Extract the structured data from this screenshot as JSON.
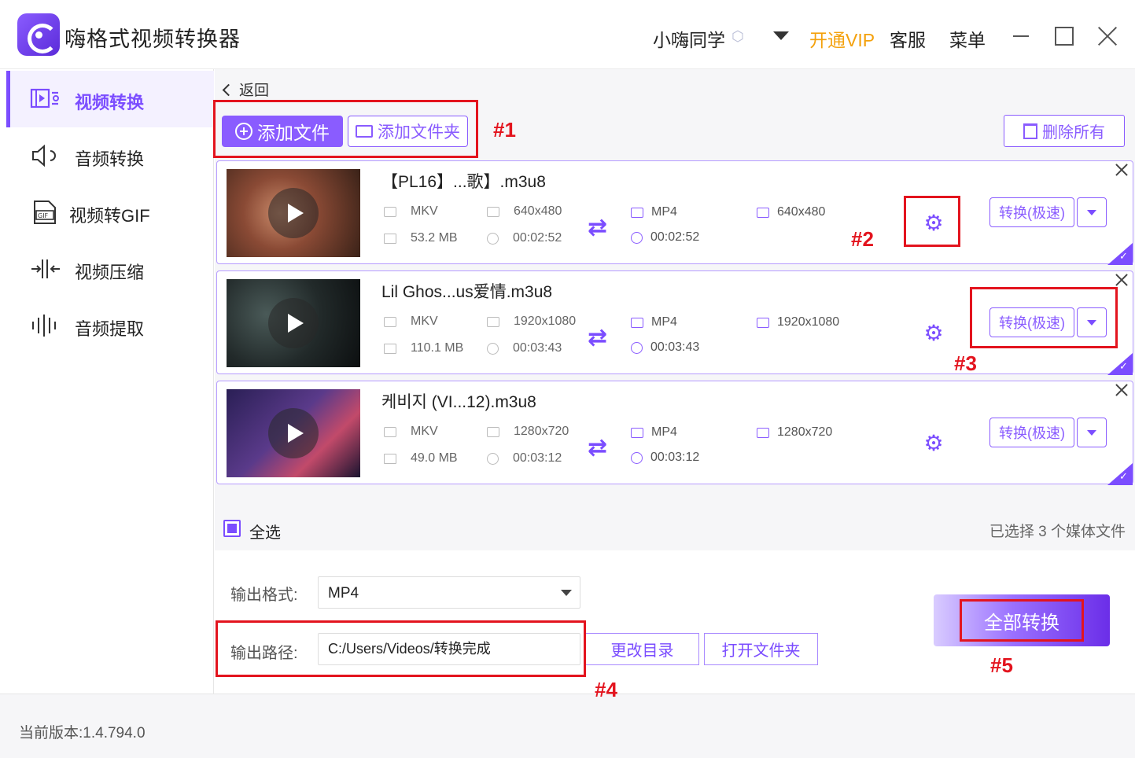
{
  "app": {
    "title": "嗨格式视频转换器",
    "user": "小嗨同学",
    "vip": "开通VIP",
    "service": "客服",
    "menu": "菜单",
    "accent_color": "#7b4dff",
    "vip_color": "#f4a10c"
  },
  "sidebar": {
    "items": [
      {
        "label": "视频转换",
        "icon": "video-convert-icon",
        "active": true
      },
      {
        "label": "音频转换",
        "icon": "audio-convert-icon",
        "active": false
      },
      {
        "label": "视频转GIF",
        "icon": "gif-icon",
        "active": false
      },
      {
        "label": "视频压缩",
        "icon": "compress-icon",
        "active": false
      },
      {
        "label": "音频提取",
        "icon": "audio-extract-icon",
        "active": false
      }
    ]
  },
  "toolbar": {
    "back": "返回",
    "add_file": "添加文件",
    "add_folder": "添加文件夹",
    "delete_all": "删除所有"
  },
  "files": [
    {
      "name": "【PL16】...歌】.m3u8",
      "in_format": "MKV",
      "in_resolution": "640x480",
      "in_size": "53.2 MB",
      "in_duration": "00:02:52",
      "out_format": "MP4",
      "out_resolution": "640x480",
      "out_duration": "00:02:52",
      "convert_label": "转换(极速)"
    },
    {
      "name": "Lil Ghos...us爱情.m3u8",
      "in_format": "MKV",
      "in_resolution": "1920x1080",
      "in_size": "110.1 MB",
      "in_duration": "00:03:43",
      "out_format": "MP4",
      "out_resolution": "1920x1080",
      "out_duration": "00:03:43",
      "convert_label": "转换(极速)"
    },
    {
      "name": "케비지 (VI...12).m3u8",
      "in_format": "MKV",
      "in_resolution": "1280x720",
      "in_size": "49.0 MB",
      "in_duration": "00:03:12",
      "out_format": "MP4",
      "out_resolution": "1280x720",
      "out_duration": "00:03:12",
      "convert_label": "转换(极速)"
    }
  ],
  "selection": {
    "select_all": "全选",
    "count_text": "已选择 3 个媒体文件"
  },
  "output": {
    "format_label": "输出格式:",
    "format_value": "MP4",
    "path_label": "输出路径:",
    "path_value": "C:/Users/Videos/转换完成",
    "change_dir": "更改目录",
    "open_folder": "打开文件夹",
    "convert_all": "全部转换"
  },
  "footer": {
    "version": "当前版本:1.4.794.0"
  },
  "annotations": [
    "#1",
    "#2",
    "#3",
    "#4",
    "#5"
  ]
}
